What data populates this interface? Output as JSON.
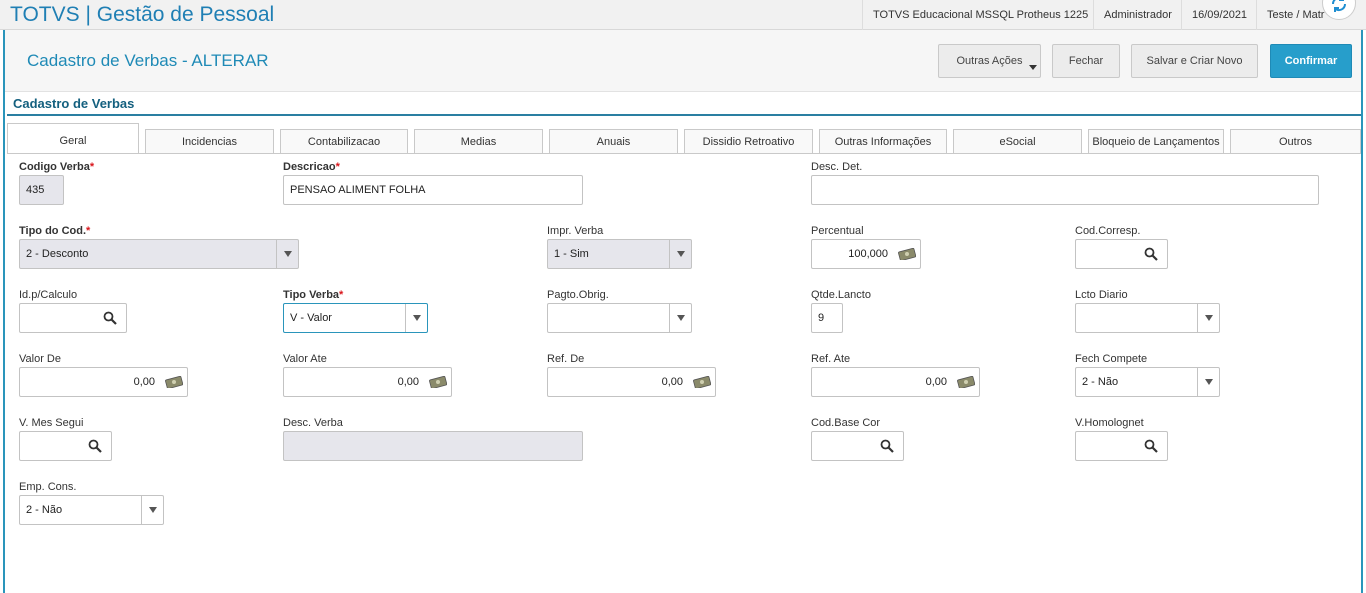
{
  "topbar": {
    "app_title": "TOTVS | Gestão de Pessoal",
    "environment": "TOTVS Educacional MSSQL Protheus 1225",
    "user": "Administrador",
    "date": "16/09/2021",
    "company": "Teste / Matr"
  },
  "header": {
    "title": "Cadastro de Verbas - ALTERAR",
    "buttons": {
      "other_actions": "Outras Ações",
      "close": "Fechar",
      "save_new": "Salvar e Criar Novo",
      "confirm": "Confirmar"
    }
  },
  "section_title": "Cadastro de Verbas",
  "tabs": [
    "Geral",
    "Incidencias",
    "Contabilizacao",
    "Medias",
    "Anuais",
    "Dissidio Retroativo",
    "Outras Informações",
    "eSocial",
    "Bloqueio de Lançamentos",
    "Outros"
  ],
  "required_mark": "*",
  "fields": {
    "codigo_verba": {
      "label": "Codigo Verba",
      "value": "435"
    },
    "descricao": {
      "label": "Descricao",
      "value": "PENSAO ALIMENT FOLHA"
    },
    "desc_det": {
      "label": "Desc. Det.",
      "value": ""
    },
    "tipo_cod": {
      "label": "Tipo do Cod.",
      "value": "2 - Desconto"
    },
    "impr_verba": {
      "label": "Impr. Verba",
      "value": "1 - Sim"
    },
    "percentual": {
      "label": "Percentual",
      "value": "100,000"
    },
    "cod_corresp": {
      "label": "Cod.Corresp.",
      "value": ""
    },
    "id_calculo": {
      "label": "Id.p/Calculo",
      "value": ""
    },
    "tipo_verba": {
      "label": "Tipo Verba",
      "value": "V - Valor"
    },
    "pagto_obrig": {
      "label": "Pagto.Obrig.",
      "value": ""
    },
    "qtde_lancto": {
      "label": "Qtde.Lancto",
      "value": "9"
    },
    "lcto_diario": {
      "label": "Lcto Diario",
      "value": ""
    },
    "valor_de": {
      "label": "Valor De",
      "value": "0,00"
    },
    "valor_ate": {
      "label": "Valor Ate",
      "value": "0,00"
    },
    "ref_de": {
      "label": "Ref. De",
      "value": "0,00"
    },
    "ref_ate": {
      "label": "Ref. Ate",
      "value": "0,00"
    },
    "fech_compete": {
      "label": "Fech Compete",
      "value": "2 - Não"
    },
    "v_mes_segui": {
      "label": "V. Mes Segui",
      "value": ""
    },
    "desc_verba": {
      "label": "Desc. Verba",
      "value": ""
    },
    "cod_base_cor": {
      "label": "Cod.Base Cor",
      "value": ""
    },
    "v_homolognet": {
      "label": "V.Homolognet",
      "value": ""
    },
    "emp_cons": {
      "label": "Emp. Cons.",
      "value": "2 - Não"
    }
  },
  "colors": {
    "accent": "#279ecb",
    "title": "#1f8ab6",
    "required": "#d9161c",
    "disabled_bg": "#e6e6ec"
  }
}
